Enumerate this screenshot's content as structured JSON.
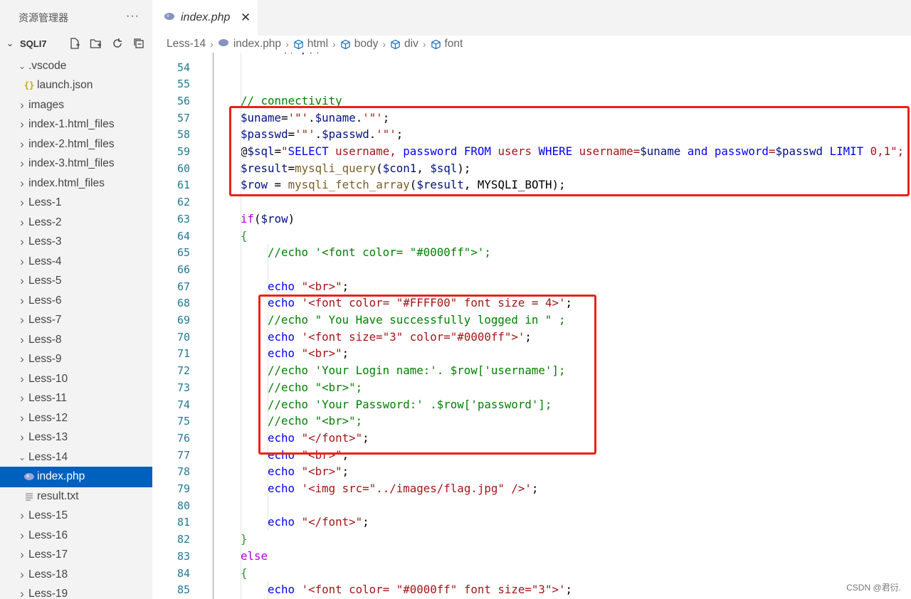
{
  "sidebar": {
    "title": "资源管理器",
    "more": "···",
    "folder": "SQLI7",
    "tree": [
      {
        "label": ".vscode",
        "type": "folder",
        "expanded": true,
        "level": 1
      },
      {
        "label": "launch.json",
        "type": "json",
        "level": 2
      },
      {
        "label": "images",
        "type": "folder",
        "expanded": false,
        "level": 1
      },
      {
        "label": "index-1.html_files",
        "type": "folder",
        "expanded": false,
        "level": 1
      },
      {
        "label": "index-2.html_files",
        "type": "folder",
        "expanded": false,
        "level": 1
      },
      {
        "label": "index-3.html_files",
        "type": "folder",
        "expanded": false,
        "level": 1
      },
      {
        "label": "index.html_files",
        "type": "folder",
        "expanded": false,
        "level": 1
      },
      {
        "label": "Less-1",
        "type": "folder",
        "expanded": false,
        "level": 1
      },
      {
        "label": "Less-2",
        "type": "folder",
        "expanded": false,
        "level": 1
      },
      {
        "label": "Less-3",
        "type": "folder",
        "expanded": false,
        "level": 1
      },
      {
        "label": "Less-4",
        "type": "folder",
        "expanded": false,
        "level": 1
      },
      {
        "label": "Less-5",
        "type": "folder",
        "expanded": false,
        "level": 1
      },
      {
        "label": "Less-6",
        "type": "folder",
        "expanded": false,
        "level": 1
      },
      {
        "label": "Less-7",
        "type": "folder",
        "expanded": false,
        "level": 1
      },
      {
        "label": "Less-8",
        "type": "folder",
        "expanded": false,
        "level": 1
      },
      {
        "label": "Less-9",
        "type": "folder",
        "expanded": false,
        "level": 1
      },
      {
        "label": "Less-10",
        "type": "folder",
        "expanded": false,
        "level": 1
      },
      {
        "label": "Less-11",
        "type": "folder",
        "expanded": false,
        "level": 1
      },
      {
        "label": "Less-12",
        "type": "folder",
        "expanded": false,
        "level": 1
      },
      {
        "label": "Less-13",
        "type": "folder",
        "expanded": false,
        "level": 1
      },
      {
        "label": "Less-14",
        "type": "folder",
        "expanded": true,
        "level": 1
      },
      {
        "label": "index.php",
        "type": "php",
        "level": 2,
        "selected": true
      },
      {
        "label": "result.txt",
        "type": "txt",
        "level": 2
      },
      {
        "label": "Less-15",
        "type": "folder",
        "expanded": false,
        "level": 1
      },
      {
        "label": "Less-16",
        "type": "folder",
        "expanded": false,
        "level": 1
      },
      {
        "label": "Less-17",
        "type": "folder",
        "expanded": false,
        "level": 1
      },
      {
        "label": "Less-18",
        "type": "folder",
        "expanded": false,
        "level": 1
      },
      {
        "label": "Less-19",
        "type": "folder",
        "expanded": false,
        "level": 1
      }
    ]
  },
  "tab": {
    "label": "index.php",
    "close": "✕"
  },
  "breadcrumb": [
    "Less-14",
    "index.php",
    "html",
    "body",
    "div",
    "font"
  ],
  "editor": {
    "partial_line": [
      {
        "t": "fclose($fp);",
        "c": "plain"
      }
    ],
    "lines": [
      {
        "num": "54",
        "indent": 0,
        "segs": []
      },
      {
        "num": "55",
        "indent": 0,
        "segs": []
      },
      {
        "num": "56",
        "indent": 0,
        "segs": [
          {
            "t": "// connectivity",
            "c": "cmt"
          }
        ]
      },
      {
        "num": "57",
        "indent": 0,
        "segs": [
          {
            "t": "$uname",
            "c": "var"
          },
          {
            "t": "=",
            "c": "plain"
          },
          {
            "t": "'\"'",
            "c": "str"
          },
          {
            "t": ".",
            "c": "plain"
          },
          {
            "t": "$uname",
            "c": "var"
          },
          {
            "t": ".",
            "c": "plain"
          },
          {
            "t": "'\"'",
            "c": "str"
          },
          {
            "t": ";",
            "c": "plain"
          }
        ]
      },
      {
        "num": "58",
        "indent": 0,
        "segs": [
          {
            "t": "$passwd",
            "c": "var"
          },
          {
            "t": "=",
            "c": "plain"
          },
          {
            "t": "'\"'",
            "c": "str"
          },
          {
            "t": ".",
            "c": "plain"
          },
          {
            "t": "$passwd",
            "c": "var"
          },
          {
            "t": ".",
            "c": "plain"
          },
          {
            "t": "'\"'",
            "c": "str"
          },
          {
            "t": ";",
            "c": "plain"
          }
        ]
      },
      {
        "num": "59",
        "indent": 0,
        "segs": [
          {
            "t": "@",
            "c": "plain"
          },
          {
            "t": "$sql",
            "c": "var"
          },
          {
            "t": "=",
            "c": "plain"
          },
          {
            "t": "\"",
            "c": "str"
          },
          {
            "t": "SELECT",
            "c": "kw"
          },
          {
            "t": " username, ",
            "c": "str"
          },
          {
            "t": "password",
            "c": "kw"
          },
          {
            "t": " ",
            "c": "str"
          },
          {
            "t": "FROM",
            "c": "kw"
          },
          {
            "t": " users ",
            "c": "str"
          },
          {
            "t": "WHERE",
            "c": "kw"
          },
          {
            "t": " username=",
            "c": "str"
          },
          {
            "t": "$uname",
            "c": "var"
          },
          {
            "t": " ",
            "c": "str"
          },
          {
            "t": "and",
            "c": "kw"
          },
          {
            "t": " ",
            "c": "str"
          },
          {
            "t": "password",
            "c": "kw"
          },
          {
            "t": "=",
            "c": "str"
          },
          {
            "t": "$passwd",
            "c": "var"
          },
          {
            "t": " ",
            "c": "str"
          },
          {
            "t": "LIMIT",
            "c": "kw"
          },
          {
            "t": " 0,1\";",
            "c": "str"
          }
        ]
      },
      {
        "num": "60",
        "indent": 0,
        "segs": [
          {
            "t": "$result",
            "c": "var"
          },
          {
            "t": "=",
            "c": "plain"
          },
          {
            "t": "mysqli_query",
            "c": "fn"
          },
          {
            "t": "(",
            "c": "plain"
          },
          {
            "t": "$con1",
            "c": "var"
          },
          {
            "t": ", ",
            "c": "plain"
          },
          {
            "t": "$sql",
            "c": "var"
          },
          {
            "t": ");",
            "c": "plain"
          }
        ]
      },
      {
        "num": "61",
        "indent": 0,
        "segs": [
          {
            "t": "$row",
            "c": "var"
          },
          {
            "t": " = ",
            "c": "plain"
          },
          {
            "t": "mysqli_fetch_array",
            "c": "fn"
          },
          {
            "t": "(",
            "c": "plain"
          },
          {
            "t": "$result",
            "c": "var"
          },
          {
            "t": ", MYSQLI_BOTH);",
            "c": "plain"
          }
        ]
      },
      {
        "num": "62",
        "indent": 0,
        "segs": []
      },
      {
        "num": "63",
        "indent": 0,
        "segs": [
          {
            "t": "if",
            "c": "ctl"
          },
          {
            "t": "(",
            "c": "plain"
          },
          {
            "t": "$row",
            "c": "var"
          },
          {
            "t": ")",
            "c": "plain"
          }
        ]
      },
      {
        "num": "64",
        "indent": 0,
        "segs": [
          {
            "t": "{",
            "c": "br"
          }
        ]
      },
      {
        "num": "65",
        "indent": 1,
        "segs": [
          {
            "t": "//echo '<font color= \"#0000ff\">';",
            "c": "cmt"
          }
        ]
      },
      {
        "num": "66",
        "indent": 1,
        "segs": []
      },
      {
        "num": "67",
        "indent": 1,
        "segs": [
          {
            "t": "echo",
            "c": "kw"
          },
          {
            "t": " ",
            "c": "plain"
          },
          {
            "t": "\"<br>\"",
            "c": "str"
          },
          {
            "t": ";",
            "c": "plain"
          }
        ]
      },
      {
        "num": "68",
        "indent": 1,
        "segs": [
          {
            "t": "echo",
            "c": "kw"
          },
          {
            "t": " ",
            "c": "plain"
          },
          {
            "t": "'<font color= \"#FFFF00\" font size = 4>'",
            "c": "str"
          },
          {
            "t": ";",
            "c": "plain"
          }
        ]
      },
      {
        "num": "69",
        "indent": 1,
        "segs": [
          {
            "t": "//echo \" You Have successfully logged in \" ;",
            "c": "cmt"
          }
        ]
      },
      {
        "num": "70",
        "indent": 1,
        "segs": [
          {
            "t": "echo",
            "c": "kw"
          },
          {
            "t": " ",
            "c": "plain"
          },
          {
            "t": "'<font size=\"3\" color=\"#0000ff\">'",
            "c": "str"
          },
          {
            "t": ";",
            "c": "plain"
          }
        ]
      },
      {
        "num": "71",
        "indent": 1,
        "segs": [
          {
            "t": "echo",
            "c": "kw"
          },
          {
            "t": " ",
            "c": "plain"
          },
          {
            "t": "\"<br>\"",
            "c": "str"
          },
          {
            "t": ";",
            "c": "plain"
          }
        ]
      },
      {
        "num": "72",
        "indent": 1,
        "segs": [
          {
            "t": "//echo 'Your Login name:'. $row['username'];",
            "c": "cmt"
          }
        ]
      },
      {
        "num": "73",
        "indent": 1,
        "segs": [
          {
            "t": "//echo \"<br>\";",
            "c": "cmt"
          }
        ]
      },
      {
        "num": "74",
        "indent": 1,
        "segs": [
          {
            "t": "//echo 'Your Password:' .$row['password'];",
            "c": "cmt"
          }
        ]
      },
      {
        "num": "75",
        "indent": 1,
        "segs": [
          {
            "t": "//echo \"<br>\";",
            "c": "cmt"
          }
        ]
      },
      {
        "num": "76",
        "indent": 1,
        "segs": [
          {
            "t": "echo",
            "c": "kw"
          },
          {
            "t": " ",
            "c": "plain"
          },
          {
            "t": "\"</font>\"",
            "c": "str"
          },
          {
            "t": ";",
            "c": "plain"
          }
        ]
      },
      {
        "num": "77",
        "indent": 1,
        "segs": [
          {
            "t": "echo",
            "c": "kw"
          },
          {
            "t": " ",
            "c": "plain"
          },
          {
            "t": "\"<br>\"",
            "c": "str"
          },
          {
            "t": ";",
            "c": "plain"
          }
        ]
      },
      {
        "num": "78",
        "indent": 1,
        "segs": [
          {
            "t": "echo",
            "c": "kw"
          },
          {
            "t": " ",
            "c": "plain"
          },
          {
            "t": "\"<br>\"",
            "c": "str"
          },
          {
            "t": ";",
            "c": "plain"
          }
        ]
      },
      {
        "num": "79",
        "indent": 1,
        "segs": [
          {
            "t": "echo",
            "c": "kw"
          },
          {
            "t": " ",
            "c": "plain"
          },
          {
            "t": "'<img src=\"../images/flag.jpg\" />'",
            "c": "str"
          },
          {
            "t": ";",
            "c": "plain"
          }
        ]
      },
      {
        "num": "80",
        "indent": 1,
        "segs": []
      },
      {
        "num": "81",
        "indent": 1,
        "segs": [
          {
            "t": "echo",
            "c": "kw"
          },
          {
            "t": " ",
            "c": "plain"
          },
          {
            "t": "\"</font>\"",
            "c": "str"
          },
          {
            "t": ";",
            "c": "plain"
          }
        ]
      },
      {
        "num": "82",
        "indent": 0,
        "segs": [
          {
            "t": "}",
            "c": "br"
          }
        ]
      },
      {
        "num": "83",
        "indent": 0,
        "segs": [
          {
            "t": "else",
            "c": "ctl"
          }
        ]
      },
      {
        "num": "84",
        "indent": 0,
        "segs": [
          {
            "t": "{",
            "c": "br"
          }
        ]
      },
      {
        "num": "85",
        "indent": 1,
        "segs": [
          {
            "t": "echo",
            "c": "kw"
          },
          {
            "t": " ",
            "c": "plain"
          },
          {
            "t": "'<font color= \"#0000ff\" font size=\"3\">'",
            "c": "str"
          },
          {
            "t": ";",
            "c": "plain"
          }
        ]
      }
    ]
  },
  "watermark": "CSDN @君衍.",
  "colors": {
    "highlight_box": "#e8221a",
    "selection": "#0060c0",
    "line_number": "#237893"
  }
}
